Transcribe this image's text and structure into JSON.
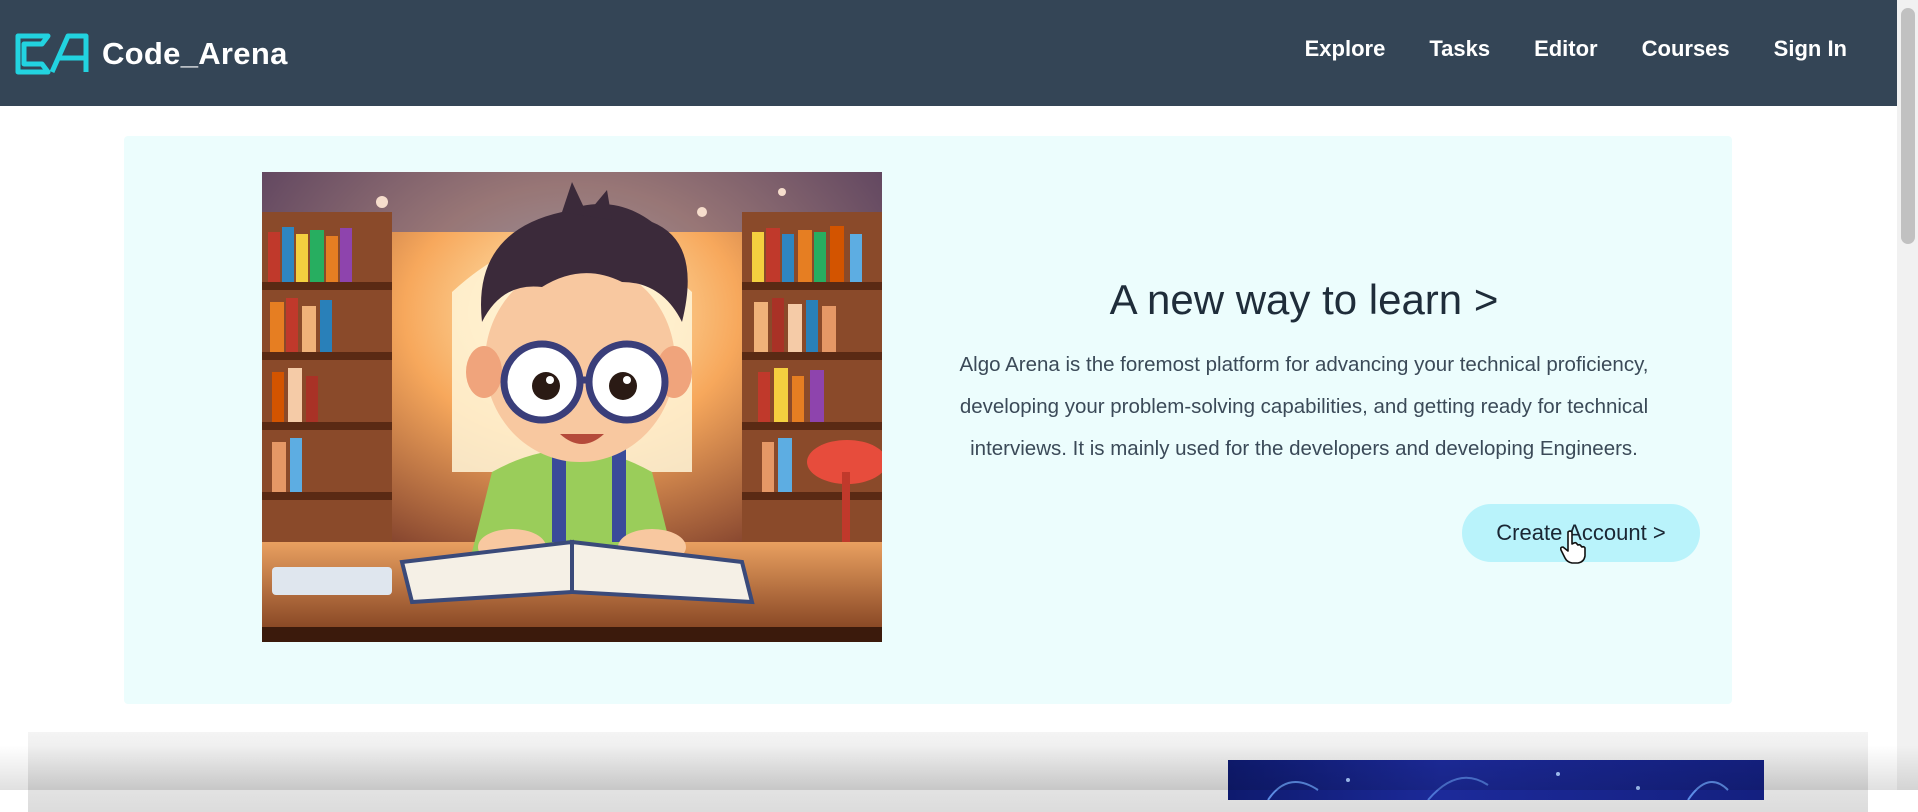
{
  "brand": {
    "name": "Code_Arena",
    "logo_text": "CA",
    "accent": "#22d3e0"
  },
  "nav": {
    "items": [
      {
        "label": "Explore"
      },
      {
        "label": "Tasks"
      },
      {
        "label": "Editor"
      },
      {
        "label": "Courses"
      },
      {
        "label": "Sign In"
      }
    ]
  },
  "hero": {
    "title": "A new way to learn >",
    "description": "Algo Arena is the foremost platform for advancing your technical proficiency, developing your problem-solving capabilities, and getting ready for technical interviews. It is mainly used for the developers and developing Engineers.",
    "cta_label": "Create Account >",
    "image_icon": "boy-reading-book-illustration"
  },
  "colors": {
    "navbar_bg": "#344556",
    "hero_bg": "#ecfdfd",
    "cta_bg": "#b9f3fb"
  }
}
